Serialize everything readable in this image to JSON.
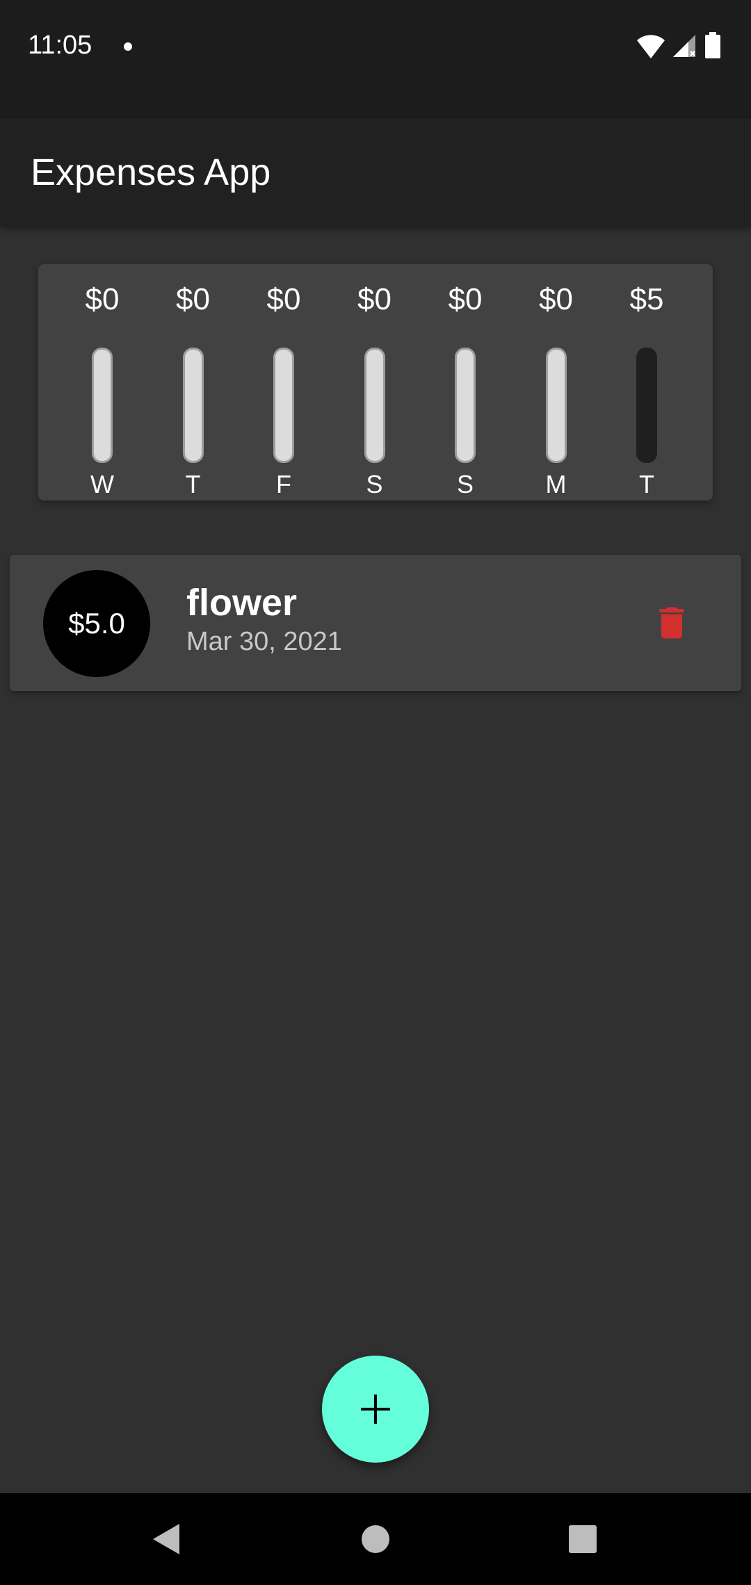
{
  "status_bar": {
    "time": "11:05",
    "icons": [
      "notification-dot-icon",
      "wifi-icon",
      "signal-icon",
      "battery-icon"
    ]
  },
  "app_bar": {
    "title": "Expenses App"
  },
  "chart": {
    "days": [
      {
        "amount": "$0",
        "label": "W",
        "fraction": 0
      },
      {
        "amount": "$0",
        "label": "T",
        "fraction": 0
      },
      {
        "amount": "$0",
        "label": "F",
        "fraction": 0
      },
      {
        "amount": "$0",
        "label": "S",
        "fraction": 0
      },
      {
        "amount": "$0",
        "label": "S",
        "fraction": 0
      },
      {
        "amount": "$0",
        "label": "M",
        "fraction": 0
      },
      {
        "amount": "$5",
        "label": "T",
        "fraction": 1
      }
    ],
    "colors": {
      "track": "#dcdcdc",
      "fill": "#1f1f1f"
    }
  },
  "transactions": [
    {
      "amount": "$5.0",
      "title": "flower",
      "date": "Mar 30, 2021",
      "delete_icon": "trash-icon"
    }
  ],
  "fab": {
    "icon": "plus-icon",
    "color": "#64ffda"
  },
  "nav_bar": {
    "icons": [
      "back-icon",
      "home-icon",
      "recents-icon"
    ]
  },
  "colors": {
    "background": "#303030",
    "app_bar": "#212121",
    "card": "#424242",
    "delete": "#d32f2f",
    "accent": "#64ffda"
  }
}
